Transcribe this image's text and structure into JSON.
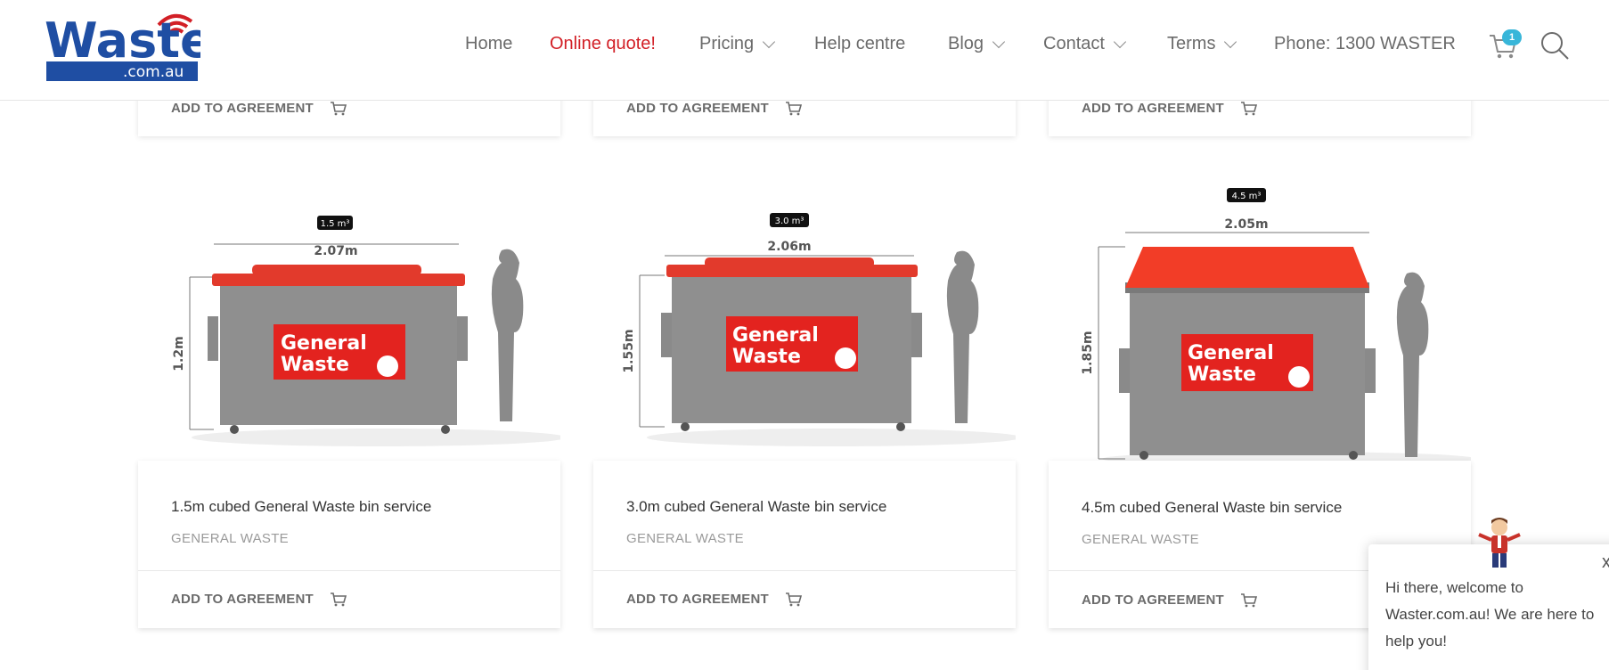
{
  "header": {
    "logo_text": "Waster",
    "logo_sub": ".com.au",
    "nav": [
      {
        "label": "Home",
        "active": false,
        "dropdown": false
      },
      {
        "label": "Online quote!",
        "active": true,
        "dropdown": false
      },
      {
        "label": "Pricing",
        "active": false,
        "dropdown": true
      },
      {
        "label": "Help centre",
        "active": false,
        "dropdown": false
      },
      {
        "label": "Blog",
        "active": false,
        "dropdown": true
      },
      {
        "label": "Contact",
        "active": false,
        "dropdown": true
      },
      {
        "label": "Terms",
        "active": false,
        "dropdown": true
      },
      {
        "label": "Phone: 1300 WASTER",
        "active": false,
        "dropdown": false
      }
    ],
    "cart_count": "1"
  },
  "colors": {
    "accent": "#d21f26",
    "badge": "#38b6d9",
    "bin_lid": "#e23a2c",
    "bin_body": "#8f8f8f"
  },
  "top_row": [
    {
      "add_label": "ADD TO AGREEMENT"
    },
    {
      "add_label": "ADD TO AGREEMENT"
    },
    {
      "add_label": "ADD TO AGREEMENT"
    }
  ],
  "products": [
    {
      "title": "1.5m cubed General Waste bin service",
      "category": "GENERAL WASTE",
      "add_label": "ADD TO AGREEMENT",
      "volume": "1.5 m³",
      "width": "2.07m",
      "height": "1.2m",
      "sign_line1": "General",
      "sign_line2": "Waste"
    },
    {
      "title": "3.0m cubed General Waste bin service",
      "category": "GENERAL WASTE",
      "add_label": "ADD TO AGREEMENT",
      "volume": "3.0 m³",
      "width": "2.06m",
      "height": "1.55m",
      "sign_line1": "General",
      "sign_line2": "Waste"
    },
    {
      "title": "4.5m cubed General Waste bin service",
      "category": "GENERAL WASTE",
      "add_label": "ADD TO AGREEMENT",
      "volume": "4.5 m³",
      "width": "2.05m",
      "height": "1.85m",
      "sign_line1": "General",
      "sign_line2": "Waste"
    }
  ],
  "chat": {
    "message": "Hi there, welcome to Waster.com.au! We are here to help you!",
    "close": "x"
  }
}
